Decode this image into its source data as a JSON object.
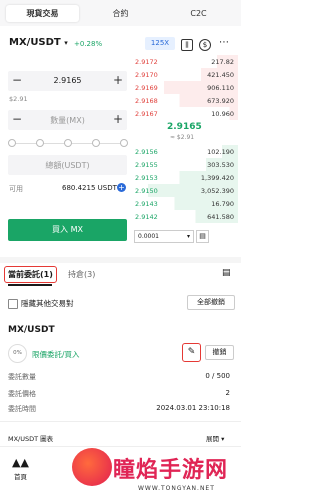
{
  "top_tabs": [
    "現貨交易",
    "合約",
    "C2C"
  ],
  "pair": "MX/USDT",
  "change": "+0.28%",
  "leverage": "125X",
  "price_input": "2.9165",
  "price_usd": "$2.91",
  "qty_placeholder": "數量(MX)",
  "total_placeholder": "總額(USDT)",
  "available_label": "可用",
  "available_value": "680.4215 USDT",
  "buy_label": "買入 MX",
  "asks": [
    {
      "p": "2.9172",
      "q": "217.82"
    },
    {
      "p": "2.9170",
      "q": "421.450"
    },
    {
      "p": "2.9169",
      "q": "906.110"
    },
    {
      "p": "2.9168",
      "q": "673.920"
    },
    {
      "p": "2.9167",
      "q": "10.960"
    }
  ],
  "mid_price": "2.9165",
  "mid_usd": "≈ $2.91",
  "bids": [
    {
      "p": "2.9156",
      "q": "102.190"
    },
    {
      "p": "2.9155",
      "q": "303.530"
    },
    {
      "p": "2.9153",
      "q": "1,399.420"
    },
    {
      "p": "2.9150",
      "q": "3,052.390"
    },
    {
      "p": "2.9143",
      "q": "16.790"
    },
    {
      "p": "2.9142",
      "q": "641.580"
    }
  ],
  "depth_select": "0.0001",
  "orders_tab": "當前委託(1)",
  "positions_tab": "持倉(3)",
  "hide_other": "隱藏其他交易對",
  "cancel_all": "全部撤銷",
  "order": {
    "pair": "MX/USDT",
    "progress": "0%",
    "type": "限價委託/買入",
    "cancel": "撤銷",
    "amount_label": "委託數量",
    "amount_value": "0 / 500",
    "price_label": "委託價格",
    "price_value": "2",
    "time_label": "委託時間",
    "time_value": "2024.03.01 23:10:18"
  },
  "chart_label": "MX/USDT 圖表",
  "expand_label": "展開",
  "home_label": "首頁",
  "watermark": "瞳焰手游网",
  "watermark_url": "WWW.TONGYAN.NET"
}
